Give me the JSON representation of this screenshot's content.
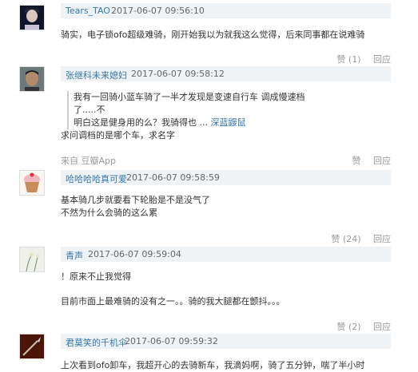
{
  "actions": {
    "reply": "回应"
  },
  "comments": [
    {
      "user": "Tears_TAO",
      "time": "2017-06-07 09:56:10",
      "lines": [
        "骑实，电子锁ofo超级难骑，刚开始我以为就我这么觉得，后来同事都在说难骑"
      ],
      "likes": "赞 (1)"
    },
    {
      "user": "张继科未来媳妇",
      "time": "2017-06-07 09:58:12",
      "quote": [
        "我有一回骑小蓝车骑了一半才发现是变速自行车 调成慢速档了.....不",
        "明白这是健身用的么？我骑得也 ...   "
      ],
      "quote_link": "深蓝鼹鼠",
      "lines": [
        "求问调档的是哪个车，求名字"
      ],
      "source": "来自 豆瓣App",
      "likes": "赞"
    },
    {
      "user": "哈哈哈哈真可爱",
      "time": "2017-06-07 09:58:59",
      "lines": [
        "基本骑几步就要看下轮胎是不是没气了",
        "不然为什么会骑的这么累"
      ],
      "likes": "赞 (24)"
    },
    {
      "user": "青声",
      "time": "2017-06-07 09:59:04",
      "lines": [
        "！原来不止我觉得",
        "目前市面上最难骑的没有之一。。骑的我大腿都在颤抖。。。"
      ],
      "likes": "赞 (2)"
    },
    {
      "user": "君莫笑的千机伞",
      "time": "2017-06-07 09:59:32",
      "lines": [
        "上次看到ofo卸车，我超开心的去骑新车，我滴妈啊，骑了五分钟，喘了半小时"
      ],
      "likes": ""
    }
  ]
}
